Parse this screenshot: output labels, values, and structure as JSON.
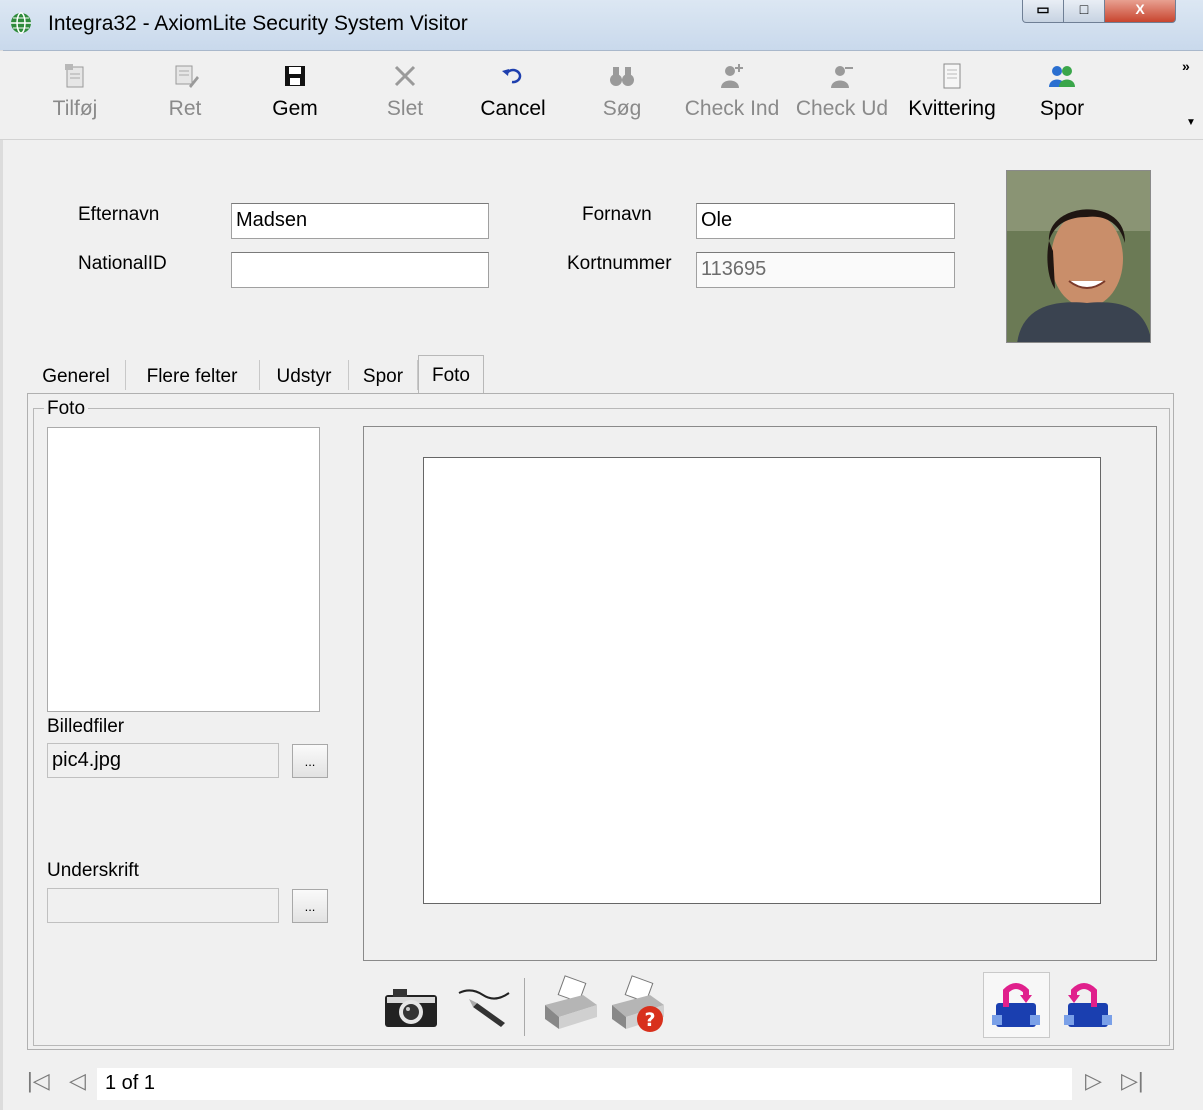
{
  "window": {
    "title": "Integra32 - AxiomLite Security System Visitor",
    "minimize_glyph": "▭",
    "maximize_glyph": "□",
    "close_glyph": "X"
  },
  "toolbar": {
    "add": {
      "label": "Tilføj",
      "icon": "add-record-icon",
      "enabled": false
    },
    "edit": {
      "label": "Ret",
      "icon": "edit-icon",
      "enabled": false
    },
    "save": {
      "label": "Gem",
      "icon": "floppy-disk-icon",
      "enabled": true
    },
    "delete": {
      "label": "Slet",
      "icon": "delete-x-icon",
      "enabled": false
    },
    "cancel": {
      "label": "Cancel",
      "icon": "undo-arrow-icon",
      "enabled": true
    },
    "search": {
      "label": "Søg",
      "icon": "binoculars-icon",
      "enabled": false
    },
    "check_in": {
      "label": "Check Ind",
      "icon": "person-check-in-icon",
      "enabled": false
    },
    "check_out": {
      "label": "Check Ud",
      "icon": "person-check-out-icon",
      "enabled": false
    },
    "receipt": {
      "label": "Kvittering",
      "icon": "document-icon",
      "enabled": true
    },
    "trace": {
      "label": "Spor",
      "icon": "people-icon",
      "enabled": true
    },
    "overflow": "»"
  },
  "form": {
    "lastname_label": "Efternavn",
    "lastname_value": "Madsen",
    "firstname_label": "Fornavn",
    "firstname_value": "Ole",
    "nationalid_label": "NationalID",
    "nationalid_value": "",
    "cardnumber_label": "Kortnummer",
    "cardnumber_value": "113695"
  },
  "tabs": [
    {
      "label": "Generel",
      "active": false
    },
    {
      "label": "Flere felter",
      "active": false
    },
    {
      "label": "Udstyr",
      "active": false
    },
    {
      "label": "Spor",
      "active": false
    },
    {
      "label": "Foto",
      "active": true
    }
  ],
  "foto_panel": {
    "group_title": "Foto",
    "image_files_label": "Billedfiler",
    "image_file_value": "pic4.jpg",
    "browse_label": "...",
    "signature_label": "Underskrift",
    "signature_value": ""
  },
  "bottom_tools": [
    "camera-icon",
    "signature-pen-icon",
    "fax-printer-icon",
    "fax-help-icon",
    "import-icon",
    "export-icon"
  ],
  "navigation": {
    "record_text": "1 of 1",
    "first": "|◁",
    "prev": "◁",
    "next": "▷",
    "last": "▷|"
  },
  "colors": {
    "accent_red": "#c8452f",
    "icon_blue": "#1a3fb0",
    "icon_magenta": "#e0208c"
  }
}
